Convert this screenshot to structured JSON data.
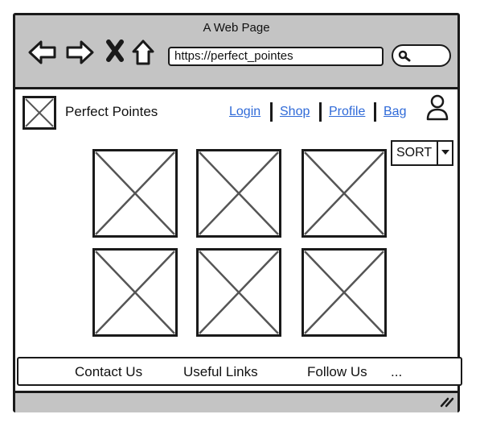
{
  "window": {
    "title": "A Web Page"
  },
  "browser": {
    "back_icon": "arrow-left-icon",
    "forward_icon": "arrow-right-icon",
    "stop_icon": "close-icon",
    "home_icon": "home-icon",
    "url": "https://perfect_pointes",
    "search_icon": "search-icon"
  },
  "site": {
    "logo_icon": "image-placeholder-icon",
    "brand": "Perfect Pointes",
    "nav": {
      "login": "Login",
      "shop": "Shop",
      "profile": "Profile",
      "bag": "Bag"
    },
    "user_icon": "user-icon"
  },
  "sort": {
    "label": "SORT",
    "arrow_icon": "caret-down-icon"
  },
  "products": [
    {
      "icon": "image-placeholder-icon"
    },
    {
      "icon": "image-placeholder-icon"
    },
    {
      "icon": "image-placeholder-icon"
    },
    {
      "icon": "image-placeholder-icon"
    },
    {
      "icon": "image-placeholder-icon"
    },
    {
      "icon": "image-placeholder-icon"
    }
  ],
  "footer": {
    "contact": "Contact Us",
    "links": "Useful Links",
    "follow": "Follow Us",
    "more": "..."
  },
  "statusbar": {
    "resize_icon": "resize-grip-icon"
  },
  "colors": {
    "chrome": "#c4c4c4",
    "link": "#2f6ad8",
    "stroke": "#1a1a1a",
    "placeholder": "#555555"
  }
}
